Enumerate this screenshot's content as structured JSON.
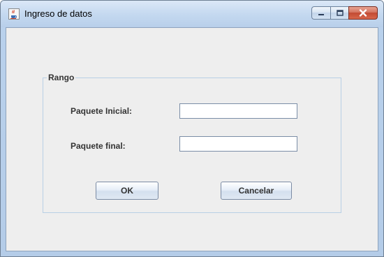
{
  "window": {
    "title": "Ingreso de datos",
    "icon": "java-cup-icon"
  },
  "title_controls": {
    "minimize": "minimize-icon",
    "maximize": "maximize-icon",
    "close": "close-icon"
  },
  "group": {
    "title": "Rango"
  },
  "fields": {
    "initial_label": "Paquete Inicial:",
    "initial_value": "",
    "final_label": "Paquete final:",
    "final_value": ""
  },
  "buttons": {
    "ok_label": "OK",
    "cancel_label": "Cancelar"
  },
  "colors": {
    "titlebar": "#c5d9f0",
    "client_bg": "#eeeeee",
    "close_button": "#c24a32",
    "group_border": "#b8cfe5"
  }
}
